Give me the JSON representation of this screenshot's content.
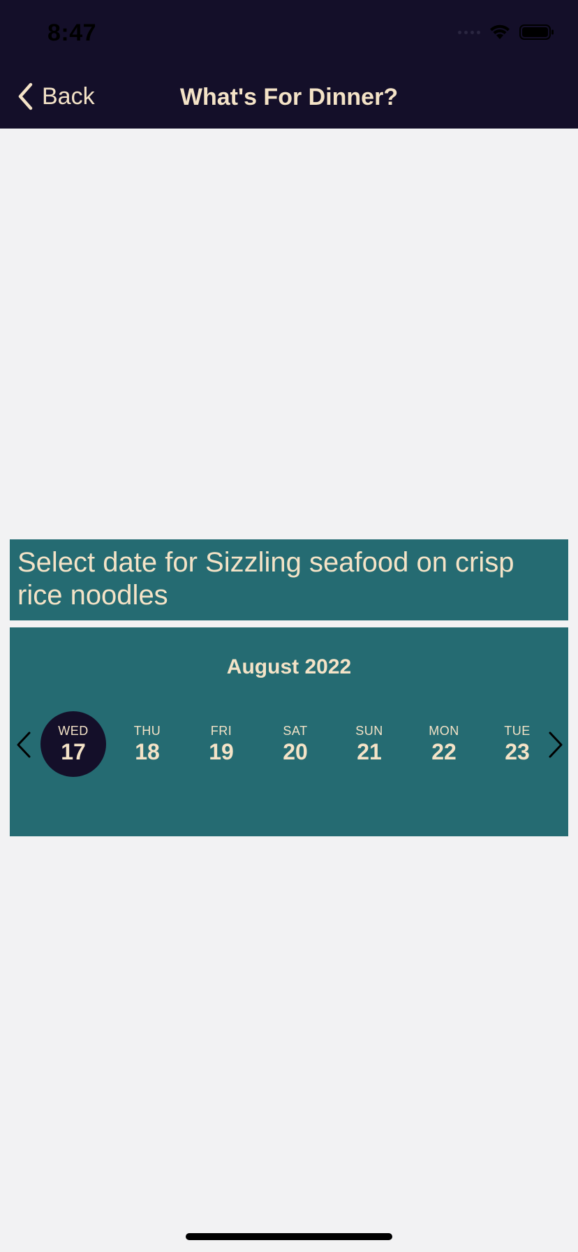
{
  "status_bar": {
    "time": "8:47"
  },
  "nav": {
    "back_label": "Back",
    "title": "What's For Dinner?"
  },
  "prompt": {
    "text": "Select date for Sizzling seafood on crisp rice noodles"
  },
  "calendar": {
    "month": "August 2022",
    "selected_index": 0,
    "days": [
      {
        "name": "WED",
        "num": "17"
      },
      {
        "name": "THU",
        "num": "18"
      },
      {
        "name": "FRI",
        "num": "19"
      },
      {
        "name": "SAT",
        "num": "20"
      },
      {
        "name": "SUN",
        "num": "21"
      },
      {
        "name": "MON",
        "num": "22"
      },
      {
        "name": "TUE",
        "num": "23"
      }
    ]
  },
  "icons": {
    "back": "chevron-left-icon",
    "prev": "chevron-left-icon",
    "next": "chevron-right-icon",
    "wifi": "wifi-icon",
    "battery": "battery-icon"
  },
  "colors": {
    "header_bg": "#140f29",
    "accent_text": "#f4e3c7",
    "teal": "#256b72",
    "page_bg": "#f2f2f3"
  }
}
